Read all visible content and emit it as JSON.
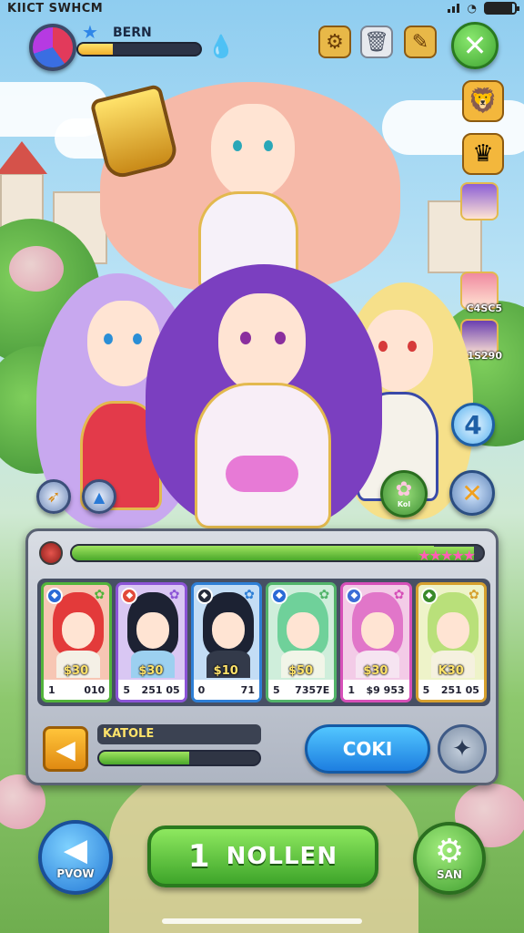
{
  "status_bar": {
    "title": "KIICT SWHCM",
    "battery_level": 0.9
  },
  "player": {
    "name": "BERN",
    "xp_fraction": 0.28,
    "avatar_icon": "crystal-orb-icon",
    "rank_icon": "star-icon"
  },
  "top_icons": [
    "lantern-scroll-icon",
    "trash-can-icon",
    "map-shard-icon"
  ],
  "close_button": "✕",
  "side_menu": {
    "items": [
      "lion-head-icon",
      "crown-hammer-icon"
    ],
    "portrait_labels": [
      "C4SC5",
      "1S290"
    ]
  },
  "hero_buttons": {
    "level_badge": "4",
    "flower_label": "Kol"
  },
  "team_panel": {
    "power_fraction": 0.88,
    "stars": "★★★★★",
    "cards": [
      {
        "name": "red-hair-hero",
        "cost": "$30",
        "level": "1",
        "power": "010",
        "frame": "#52b43b",
        "bg": "#f7c6b4",
        "hair": "#e33a3a",
        "outfit": "#f4f0e6",
        "el": "#2a6ad6"
      },
      {
        "name": "black-hair-blue-hero",
        "cost": "$30",
        "level": "5",
        "power": "251 05",
        "frame": "#8b54d6",
        "bg": "#d9c7f3",
        "hair": "#1d2233",
        "outfit": "#9cd0f0",
        "el": "#e24a3a"
      },
      {
        "name": "black-hair-dark-hero",
        "cost": "$10",
        "level": "0",
        "power": "71",
        "frame": "#2e7fd6",
        "bg": "#c3ddf5",
        "hair": "#1c2233",
        "outfit": "#333a4a",
        "el": "#232a3a"
      },
      {
        "name": "green-hair-hero",
        "cost": "$50",
        "level": "5",
        "power": "7357E",
        "frame": "#52b46a",
        "bg": "#cfeedb",
        "hair": "#6fd19a",
        "outfit": "#f1f5e8",
        "el": "#2a6ad6"
      },
      {
        "name": "pink-hair-hero",
        "cost": "$30",
        "level": "1",
        "power": "$9 953",
        "frame": "#d64fb8",
        "bg": "#f3cbe7",
        "hair": "#e176c9",
        "outfit": "#f6e4f1",
        "el": "#3b6cd6"
      },
      {
        "name": "lime-hair-hero",
        "cost": "K30",
        "level": "5",
        "power": "251 05",
        "frame": "#d6a02e",
        "bg": "#eef3c9",
        "hair": "#b9e07a",
        "outfit": "#f5f1df",
        "el": "#3a8a2a"
      }
    ],
    "team_name": "KATOLE",
    "team_fraction": 0.56,
    "confirm_label": "COKI"
  },
  "bottom_nav": {
    "back_label": "PVOW",
    "main_number": "1",
    "main_label": "NOLLEN",
    "settings_label": "SAN"
  }
}
